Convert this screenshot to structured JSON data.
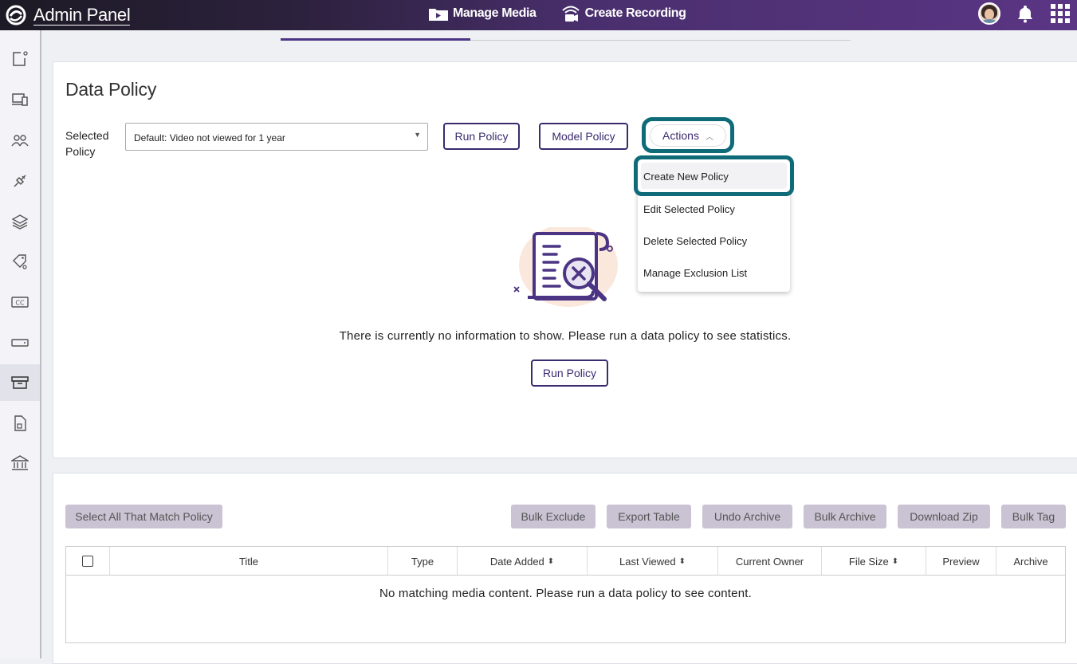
{
  "header": {
    "brand": "Admin Panel",
    "nav": [
      {
        "label": "Manage Media",
        "icon": "media-folder-icon"
      },
      {
        "label": "Create Recording",
        "icon": "recording-icon"
      }
    ],
    "icons": [
      "avatar",
      "bell-icon",
      "apps-grid-icon"
    ]
  },
  "sidebar": {
    "items": [
      {
        "icon": "new-item-icon"
      },
      {
        "icon": "devices-icon"
      },
      {
        "icon": "users-icon"
      },
      {
        "icon": "integrations-plug-icon"
      },
      {
        "icon": "layers-icon"
      },
      {
        "icon": "tags-icon"
      },
      {
        "icon": "captions-cc-icon"
      },
      {
        "icon": "storage-drive-icon"
      },
      {
        "icon": "archive-box-icon",
        "active": true
      },
      {
        "icon": "document-media-icon"
      },
      {
        "icon": "institution-icon"
      }
    ]
  },
  "policy": {
    "title": "Data Policy",
    "selected_label": "Selected Policy",
    "selected_value": "Default: Video not viewed for 1 year",
    "run_button": "Run Policy",
    "model_button": "Model Policy",
    "actions_button": "Actions",
    "actions_menu": [
      "Create New Policy",
      "Edit Selected Policy",
      "Delete Selected Policy",
      "Manage Exclusion List"
    ],
    "empty_message": "There is currently no information to show. Please run a data policy to see statistics.",
    "empty_run_button": "Run Policy"
  },
  "table_section": {
    "select_all_button": "Select All That Match Policy",
    "bulk_buttons": [
      "Bulk Exclude",
      "Export Table",
      "Undo Archive",
      "Bulk Archive",
      "Download Zip",
      "Bulk Tag"
    ],
    "columns": [
      "Title",
      "Type",
      "Date Added",
      "Last Viewed",
      "Current Owner",
      "File Size",
      "Preview",
      "Archive"
    ],
    "empty_message": "No matching media content. Please run a data policy to see content."
  },
  "colors": {
    "accent": "#4b3484",
    "highlight": "#0f6b78",
    "gray_button": "#c9c3d3"
  }
}
